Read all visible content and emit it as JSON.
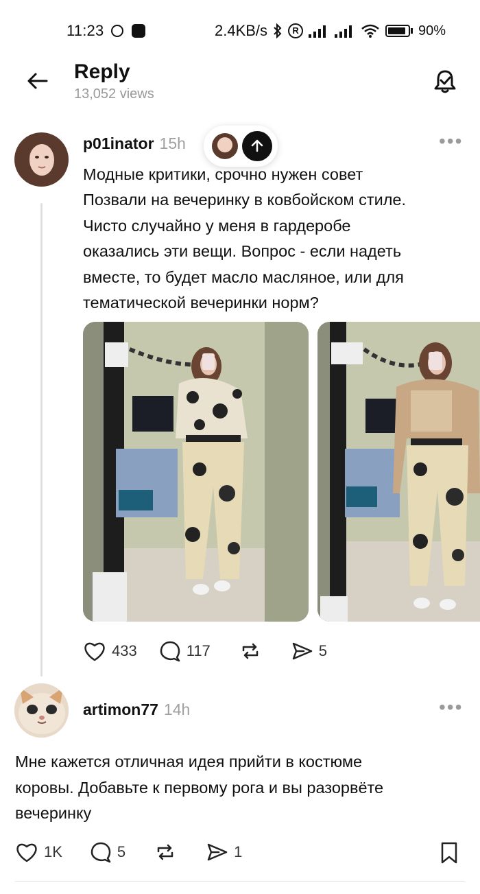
{
  "status_bar": {
    "time": "11:23",
    "net_speed": "2.4KB/s",
    "battery": "90%"
  },
  "header": {
    "title": "Reply",
    "views": "13,052 views"
  },
  "post": {
    "username": "p01inator",
    "time": "15h",
    "lines": [
      "Модные критики, срочно нужен совет",
      "Позвали на вечеринку в ковбойском стиле.",
      "Чисто случайно у меня в гардеробе",
      "оказались эти вещи. Вопрос - если надеть",
      "вместе, то будет масло масляное, или для",
      "тематической вечеринки норм?"
    ],
    "likes": "433",
    "comments": "117",
    "shares": "5"
  },
  "reply": {
    "username": "artimon77",
    "time": "14h",
    "lines": [
      "Мне кажется отличная идея прийти в костюме",
      "коровы. Добавьте к первому рога и вы разорвёте",
      "вечеринку"
    ],
    "likes": "1K",
    "comments": "5",
    "shares": "1"
  },
  "icons": {
    "back": "arrow-left-icon",
    "bell": "bell-check-icon",
    "like": "heart-icon",
    "comment": "comment-icon",
    "repost": "repost-icon",
    "share": "send-icon",
    "bookmark": "bookmark-icon",
    "more": "more-dots-icon"
  },
  "colors": {
    "text": "#111111",
    "muted": "#9a9a9a",
    "thread_line": "#e1e1e1"
  }
}
